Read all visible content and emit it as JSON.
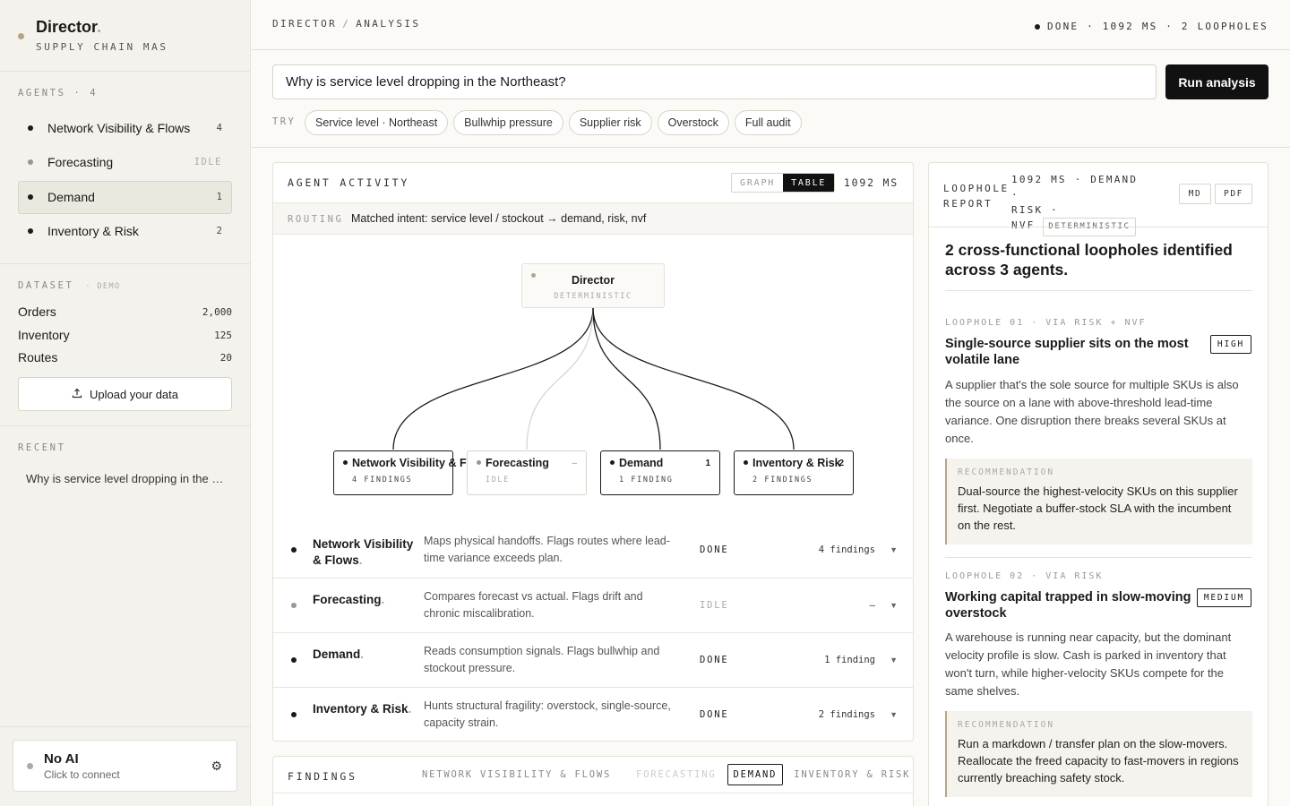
{
  "brand": {
    "title": "Director",
    "dot": ".",
    "subtitle": "SUPPLY CHAIN MAS"
  },
  "sidebar": {
    "agents_label": "AGENTS · 4",
    "agents": [
      {
        "label": "Network Visibility & Flows",
        "count": "4",
        "status": "done"
      },
      {
        "label": "Forecasting",
        "count": "IDLE",
        "status": "idle"
      },
      {
        "label": "Demand",
        "count": "1",
        "status": "done"
      },
      {
        "label": "Inventory & Risk",
        "count": "2",
        "status": "done"
      }
    ],
    "dataset_label": "DATASET",
    "dataset_tag": "· DEMO",
    "dataset": [
      {
        "label": "Orders",
        "value": "2,000"
      },
      {
        "label": "Inventory",
        "value": "125"
      },
      {
        "label": "Routes",
        "value": "20"
      }
    ],
    "upload_label": "Upload your data",
    "recent_label": "RECENT",
    "recent_item": "Why is service level dropping in the Northeast?",
    "ai_title": "No AI",
    "ai_sub": "Click to connect"
  },
  "topbar": {
    "crumb1": "DIRECTOR",
    "crumb_sep": "/",
    "crumb2": "ANALYSIS",
    "status": "DONE · 1092 MS · 2 LOOPHOLES"
  },
  "query": {
    "value": "Why is service level dropping in the Northeast?",
    "run_label": "Run analysis"
  },
  "try": {
    "label": "TRY",
    "chips": [
      "Service level · Northeast",
      "Bullwhip pressure",
      "Supplier risk",
      "Overstock",
      "Full audit"
    ]
  },
  "activity": {
    "title": "AGENT ACTIVITY",
    "seg_graph": "GRAPH",
    "seg_table": "TABLE",
    "ms": "1092 MS",
    "routing_label": "ROUTING",
    "routing_value": "Matched intent: service level / stockout → demand, risk, nvf",
    "director": {
      "name": "Director",
      "sub": "DETERMINISTIC"
    },
    "nodes": [
      {
        "name": "Network Visibility & Flows",
        "count": "",
        "sub": "4 FINDINGS"
      },
      {
        "name": "Forecasting",
        "count": "–",
        "sub": "IDLE"
      },
      {
        "name": "Demand",
        "count": "1",
        "sub": "1 FINDING"
      },
      {
        "name": "Inventory & Risk",
        "count": "2",
        "sub": "2 FINDINGS"
      }
    ],
    "rows": [
      {
        "name": "Network Visibility & Flows",
        "desc": "Maps physical handoffs. Flags routes where lead-time variance exceeds plan.",
        "status": "DONE",
        "findings": "4 findings"
      },
      {
        "name": "Forecasting",
        "desc": "Compares forecast vs actual. Flags drift and chronic miscalibration.",
        "status": "IDLE",
        "findings": "–"
      },
      {
        "name": "Demand",
        "desc": "Reads consumption signals. Flags bullwhip and stockout pressure.",
        "status": "DONE",
        "findings": "1 finding"
      },
      {
        "name": "Inventory & Risk",
        "desc": "Hunts structural fragility: overstock, single-source, capacity strain.",
        "status": "DONE",
        "findings": "2 findings"
      }
    ]
  },
  "findings": {
    "title": "FINDINGS",
    "tabs": [
      "NETWORK VISIBILITY & FLOWS",
      "FORECASTING",
      "DEMAND",
      "INVENTORY & RISK"
    ]
  },
  "report": {
    "h1": "LOOPHOLE",
    "h2": "REPORT",
    "meta1": "1092 MS · DEMAND ·",
    "meta2": "RISK ·",
    "meta3": "NVF",
    "meta_tag": "DETERMINISTIC",
    "md": "MD",
    "pdf": "PDF",
    "title": "2 cross-functional loopholes identified across 3 agents.",
    "rec_label": "RECOMMENDATION",
    "items": [
      {
        "head": "LOOPHOLE 01 · VIA RISK + NVF",
        "title": "Single-source supplier sits on the most volatile lane",
        "severity": "HIGH",
        "desc": "A supplier that's the sole source for multiple SKUs is also the source on a lane with above-threshold lead-time variance. One disruption there breaks several SKUs at once.",
        "rec": "Dual-source the highest-velocity SKUs on this supplier first. Negotiate a buffer-stock SLA with the incumbent on the rest."
      },
      {
        "head": "LOOPHOLE 02 · VIA RISK",
        "title": "Working capital trapped in slow-moving overstock",
        "severity": "MEDIUM",
        "desc": "A warehouse is running near capacity, but the dominant velocity profile is slow. Cash is parked in inventory that won't turn, while higher-velocity SKUs compete for the same shelves.",
        "rec": "Run a markdown / transfer plan on the slow-movers. Reallocate the freed capacity to fast-movers in regions currently breaching safety stock."
      }
    ]
  }
}
